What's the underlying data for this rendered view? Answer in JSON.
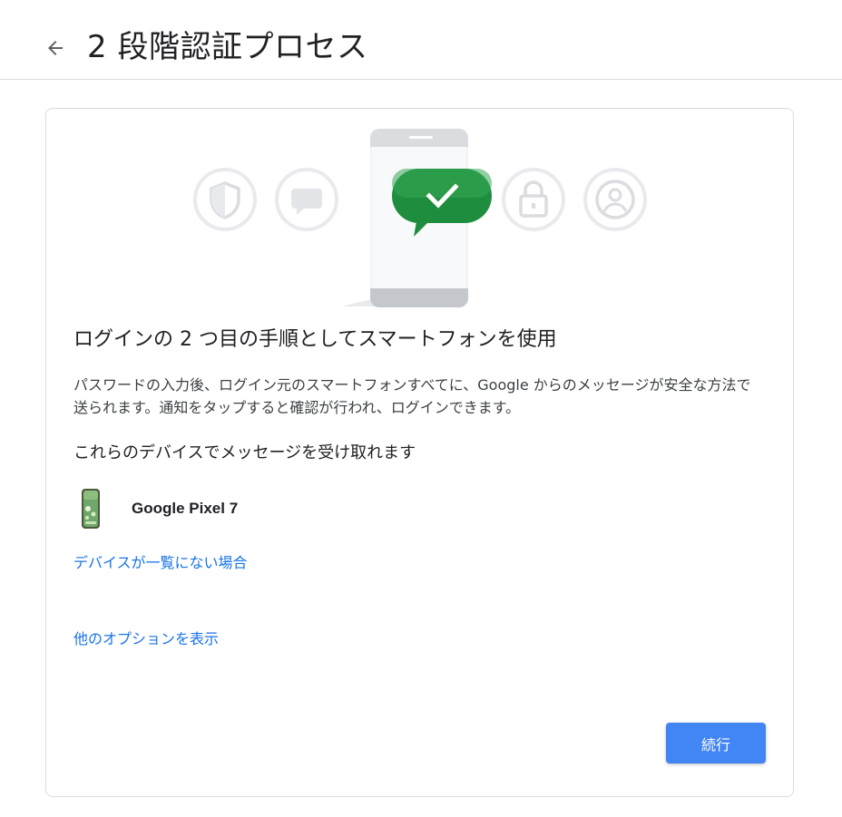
{
  "header": {
    "title": "2 段階認証プロセス",
    "back_icon": "arrow-back-icon"
  },
  "hero": {
    "icons": [
      "shield-icon",
      "chat-bubble-icon",
      "smartphone-icon",
      "checkmark-icon",
      "lock-icon",
      "account-icon"
    ],
    "accent_green": "#1e8e3e"
  },
  "main": {
    "heading": "ログインの 2 つ目の手順としてスマートフォンを使用",
    "description": "パスワードの入力後、ログイン元のスマートフォンすべてに、Google からのメッセージが安全な方法で送られます。通知をタップすると確認が行われ、ログインできます。",
    "devices_heading": "これらのデバイスでメッセージを受け取れます",
    "devices": [
      {
        "name": "Google Pixel 7",
        "icon": "pixel-phone-icon"
      }
    ],
    "link_missing_device": "デバイスが一覧にない場合",
    "link_more_options": "他のオプションを表示",
    "continue_label": "続行"
  },
  "colors": {
    "link": "#1a73e8",
    "button": "#4285f4",
    "border": "#dadce0"
  }
}
